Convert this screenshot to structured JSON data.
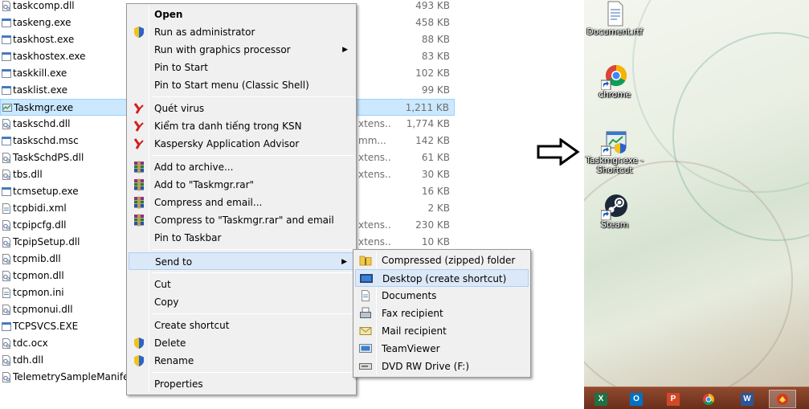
{
  "file_list": {
    "rows": [
      {
        "name": "taskcomp.dll",
        "type": "",
        "size": "493 KB"
      },
      {
        "name": "taskeng.exe",
        "type": "",
        "size": "458 KB"
      },
      {
        "name": "taskhost.exe",
        "type": "",
        "size": "88 KB"
      },
      {
        "name": "taskhostex.exe",
        "type": "",
        "size": "83 KB"
      },
      {
        "name": "taskkill.exe",
        "type": "",
        "size": "102 KB"
      },
      {
        "name": "tasklist.exe",
        "type": "",
        "size": "99 KB"
      },
      {
        "name": "Taskmgr.exe",
        "type": "",
        "size": "1,211 KB",
        "selected": true
      },
      {
        "name": "taskschd.dll",
        "type": "xtens...",
        "size": "1,774 KB"
      },
      {
        "name": "taskschd.msc",
        "type": "mm...",
        "size": "142 KB"
      },
      {
        "name": "TaskSchdPS.dll",
        "type": "xtens...",
        "size": "61 KB"
      },
      {
        "name": "tbs.dll",
        "type": "xtens...",
        "size": "30 KB"
      },
      {
        "name": "tcmsetup.exe",
        "type": "",
        "size": "16 KB"
      },
      {
        "name": "tcpbidi.xml",
        "type": "",
        "size": "2 KB"
      },
      {
        "name": "tcpipcfg.dll",
        "type": "xtens...",
        "size": "230 KB"
      },
      {
        "name": "TcpipSetup.dll",
        "type": "xtens...",
        "size": "10 KB"
      },
      {
        "name": "tcpmib.dll",
        "type": "",
        "size": ""
      },
      {
        "name": "tcpmon.dll",
        "type": "",
        "size": ""
      },
      {
        "name": "tcpmon.ini",
        "type": "",
        "size": ""
      },
      {
        "name": "tcpmonui.dll",
        "type": "",
        "size": ""
      },
      {
        "name": "TCPSVCS.EXE",
        "type": "",
        "size": ""
      },
      {
        "name": "tdc.ocx",
        "type": "",
        "size": ""
      },
      {
        "name": "tdh.dll",
        "type": "",
        "size": ""
      },
      {
        "name": "TelemetrySampleManifest",
        "type": "",
        "size": ""
      }
    ]
  },
  "context_menu": {
    "items": [
      {
        "label": "Open",
        "icon": "none",
        "bold": true
      },
      {
        "label": "Run as administrator",
        "icon": "uac-shield-icon"
      },
      {
        "label": "Run with graphics processor",
        "icon": "none",
        "submenu": true
      },
      {
        "label": "Pin to Start",
        "icon": "none"
      },
      {
        "label": "Pin to Start menu (Classic Shell)",
        "icon": "none"
      },
      {
        "sep": true
      },
      {
        "label": "Quét virus",
        "icon": "kaspersky-icon"
      },
      {
        "label": "Kiểm tra danh tiếng trong KSN",
        "icon": "kaspersky-icon"
      },
      {
        "label": "Kaspersky Application Advisor",
        "icon": "kaspersky-icon"
      },
      {
        "sep": true
      },
      {
        "label": "Add to archive...",
        "icon": "winrar-icon"
      },
      {
        "label": "Add to \"Taskmgr.rar\"",
        "icon": "winrar-icon"
      },
      {
        "label": "Compress and email...",
        "icon": "winrar-icon"
      },
      {
        "label": "Compress to \"Taskmgr.rar\" and email",
        "icon": "winrar-icon"
      },
      {
        "label": "Pin to Taskbar",
        "icon": "none"
      },
      {
        "sep": true
      },
      {
        "label": "Send to",
        "icon": "none",
        "submenu": true,
        "hover": true
      },
      {
        "sep": true
      },
      {
        "label": "Cut",
        "icon": "none"
      },
      {
        "label": "Copy",
        "icon": "none"
      },
      {
        "sep": true
      },
      {
        "label": "Create shortcut",
        "icon": "none"
      },
      {
        "label": "Delete",
        "icon": "uac-shield-icon"
      },
      {
        "label": "Rename",
        "icon": "uac-shield-icon"
      },
      {
        "sep": true
      },
      {
        "label": "Properties",
        "icon": "none"
      }
    ]
  },
  "send_to_menu": {
    "items": [
      {
        "label": "Compressed (zipped) folder",
        "icon": "zip-folder-icon"
      },
      {
        "label": "Desktop (create shortcut)",
        "icon": "desktop-icon",
        "hover": true
      },
      {
        "label": "Documents",
        "icon": "documents-icon"
      },
      {
        "label": "Fax recipient",
        "icon": "fax-icon"
      },
      {
        "label": "Mail recipient",
        "icon": "mail-icon"
      },
      {
        "label": "TeamViewer",
        "icon": "teamviewer-icon"
      },
      {
        "label": "DVD RW Drive (F:)",
        "icon": "dvd-drive-icon"
      }
    ]
  },
  "desktop": {
    "icons": [
      {
        "label": "Document.rtf",
        "icon": "rtf-document-icon"
      },
      {
        "label": "chrome",
        "icon": "chrome-icon"
      },
      {
        "label": "Taskmgr.exe - Shortcut",
        "icon": "taskmgr-shortcut-icon"
      },
      {
        "label": "Steam",
        "icon": "steam-icon"
      }
    ],
    "taskbar": [
      {
        "name": "excel-icon",
        "glyph": "X",
        "color": "#1e7145"
      },
      {
        "name": "outlook-icon",
        "glyph": "O",
        "color": "#0072c6"
      },
      {
        "name": "powerpoint-icon",
        "glyph": "P",
        "color": "#d24726"
      },
      {
        "name": "chrome-taskbar-icon",
        "glyph": "",
        "color": "#e8b730"
      },
      {
        "name": "word-icon",
        "glyph": "W",
        "color": "#2b579a"
      },
      {
        "name": "app-icon",
        "glyph": "",
        "color": "#d43a1a",
        "active": true
      }
    ]
  }
}
